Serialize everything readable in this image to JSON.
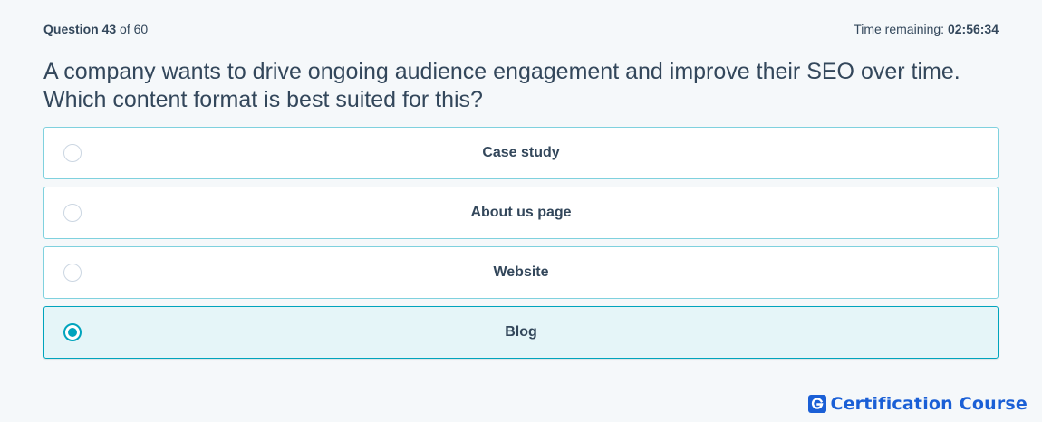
{
  "header": {
    "question_word": "Question",
    "question_number": "43",
    "of_word": "of",
    "question_total": "60",
    "time_label": "Time remaining:",
    "time_value": "02:56:34"
  },
  "question": {
    "text": "A company wants to drive ongoing audience engagement and improve their SEO over time. Which content format is best suited for this?"
  },
  "options": [
    {
      "label": "Case study",
      "selected": false
    },
    {
      "label": "About us page",
      "selected": false
    },
    {
      "label": "Website",
      "selected": false
    },
    {
      "label": "Blog",
      "selected": true
    }
  ],
  "brand": {
    "text": "Certification Course",
    "icon": "g-logo-icon",
    "color": "#1a5fd6"
  },
  "colors": {
    "accent": "#00a4bd",
    "text": "#33475b",
    "selected_bg": "#e5f5f8"
  }
}
